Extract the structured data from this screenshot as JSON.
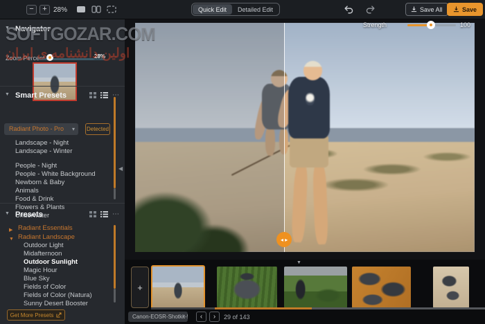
{
  "toolbar": {
    "zoom_out": "−",
    "zoom_in": "+",
    "zoom_value": "28%",
    "edit_modes": {
      "quick": "Quick Edit",
      "detailed": "Detailed Edit",
      "active": "Quick Edit"
    },
    "save_all": "Save All",
    "save": "Save"
  },
  "navigator": {
    "title": "Navigator",
    "zoom_label": "Zoom Percent",
    "zoom_value": "28%"
  },
  "smart_presets": {
    "title": "Smart Presets",
    "dropdown_value": "Radiant Photo - Pro",
    "detected_label": "Detected",
    "items": [
      "Landscape - Night",
      "Landscape - Winter",
      "",
      "People - Night",
      "People - White Background",
      "Newborn & Baby",
      "Animals",
      "Food & Drink",
      "Flowers & Plants",
      "Underwater"
    ]
  },
  "presets": {
    "title": "Presets",
    "groups": [
      {
        "label": "Radiant Essentials",
        "expanded": false,
        "items": []
      },
      {
        "label": "Radiant Landscape",
        "expanded": true,
        "selected": "Outdoor Sunlight",
        "items": [
          "Outdoor Light",
          "Midafternoon",
          "Outdoor Sunlight",
          "Magic Hour",
          "Blue Sky",
          "Fields of Color",
          "Fields of Color (Natura)",
          "Sunny Desert Booster"
        ]
      }
    ],
    "get_more_label": "Get More Presets"
  },
  "strength": {
    "label": "Strength",
    "value": "100"
  },
  "filmstrip": {
    "add_label": "+",
    "filename": "Canon-EOSR-Shotkit-5...",
    "prev": "‹",
    "next": "›",
    "counter": "29 of 143"
  },
  "watermark": {
    "line1": "SOFTGOZAR.COM",
    "line2": "اولین دانشنامه ی ایران"
  },
  "icons": {
    "section_expand": "▼",
    "group_collapsed": "▶",
    "group_expanded": "▼",
    "sidebar_collapse": "◀",
    "filmstrip_collapse": "▼",
    "dropdown_chevron": "▾",
    "overflow": "⋯",
    "compare": "◂ ▸"
  },
  "colors": {
    "accent": "#E8952D",
    "navigator_frame": "#C23B2E",
    "preset_group_text": "#C8772E"
  }
}
